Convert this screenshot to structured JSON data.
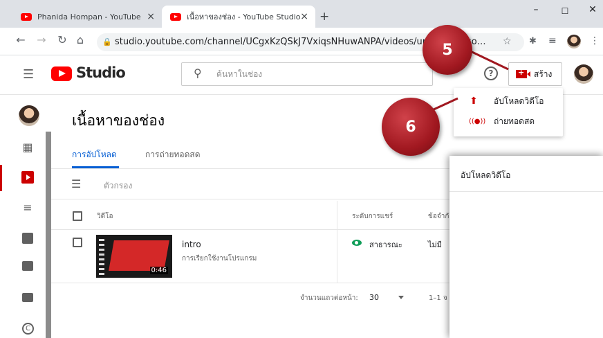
{
  "browser": {
    "tabs": [
      {
        "title": "Phanida Hompan - YouTube"
      },
      {
        "title": "เนื้อหาของช่อง - YouTube Studio"
      }
    ],
    "new_tab": "+",
    "close_glyph": "×",
    "url": "studio.youtube.com/channel/UCgxKzQSkJ7VxiqsNHuwANPA/videos/upload?fi…so…"
  },
  "studio": {
    "logo_text": "Studio",
    "search_placeholder": "ค้นหาในช่อง",
    "create_label": "สร้าง"
  },
  "dropdown": {
    "items": [
      {
        "label": "อัปโหลดวิดีโอ",
        "icon": "upload-icon"
      },
      {
        "label": "ถ่ายทอดสด",
        "icon": "live-icon"
      }
    ]
  },
  "page": {
    "title": "เนื้อหาของช่อง",
    "tabs": [
      "การอัปโหลด",
      "การถ่ายทอดสด"
    ],
    "active_tab": 0,
    "filter_label": "ตัวกรอง",
    "columns": [
      "วิดีโอ",
      "ระดับการแชร์",
      "ข้อจำกั"
    ],
    "rows": [
      {
        "title": "intro",
        "description": "การเรียกใช้งานโปรแกรม",
        "duration": "0:46",
        "visibility": "สาธารณะ",
        "restriction": "ไม่มี"
      }
    ],
    "pagination": {
      "rows_per_page_label": "จำนวนแถวต่อหน้า:",
      "rows_per_page": "30",
      "range": "1–1 จ"
    }
  },
  "upload_dialog": {
    "title": "อัปโหลดวิดีโอ"
  },
  "markers": [
    "5",
    "6"
  ],
  "colors": {
    "youtube_red": "#ff0000",
    "tab_underline": "#065fd4",
    "public_green": "#0f9d58",
    "marker": "#a11820"
  }
}
